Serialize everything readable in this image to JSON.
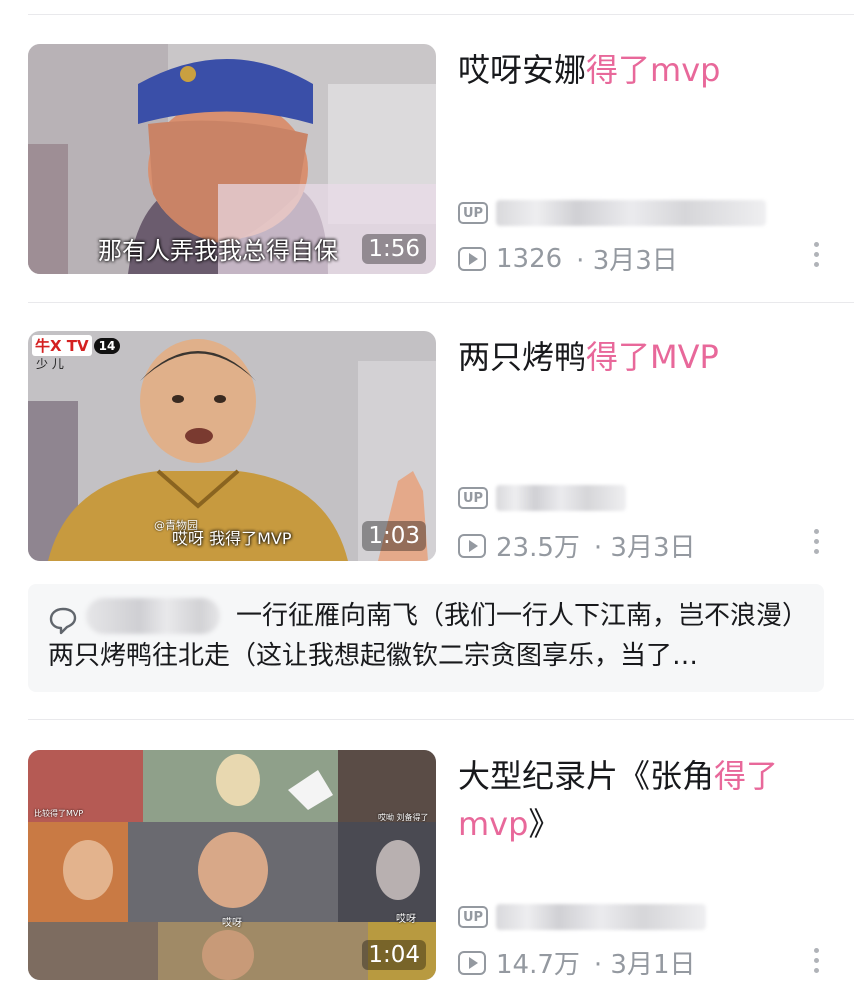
{
  "videos": [
    {
      "title_plain": "哎呀安娜",
      "title_highlight": "得了mvp",
      "duration": "1:56",
      "caption": "那有人弄我我总得自保",
      "up_badge": "UP",
      "views": "1326",
      "date": "· 3月3日"
    },
    {
      "title_plain": "两只烤鸭",
      "title_highlight": "得了MVP",
      "duration": "1:03",
      "caption": "哎呀 我得了MVP",
      "channel_logo": "牛X TV",
      "channel_sub": "少 儿",
      "channel_num": "14",
      "watermark": "@青物园",
      "up_badge": "UP",
      "views": "23.5万",
      "date": "· 3月3日"
    },
    {
      "title_plain": "大型纪录片《张角",
      "title_highlight": "得了mvp",
      "title_tail": "》",
      "duration": "1:04",
      "tile_captions": [
        "比较得了MVP",
        "哎呦 刘备得了",
        "哎呀",
        "哎呀"
      ],
      "up_badge": "UP",
      "views": "14.7万",
      "date": "· 3月1日"
    }
  ],
  "comment": {
    "text": "一行征雁向南飞（我们一行人下江南，岂不浪漫）两只烤鸭往北走（这让我想起徽钦二宗贪图享乐，当了…"
  },
  "colors": {
    "highlight": "#e8689a",
    "meta": "#9499a0",
    "text": "#18191c"
  }
}
